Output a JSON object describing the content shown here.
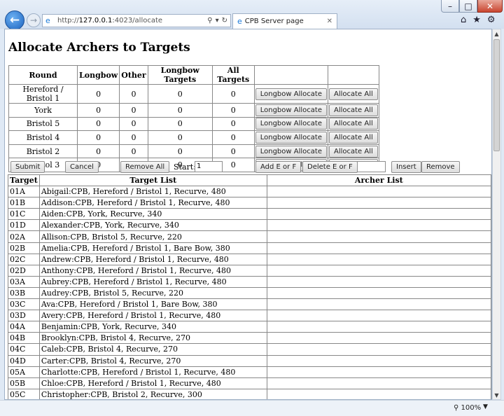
{
  "browser": {
    "url_prefix": "http://",
    "url_host": "127.0.0.1",
    "url_rest": ":4023/allocate",
    "tab_title": "CPB Server page",
    "zoom": "100%"
  },
  "page": {
    "title": "Allocate Archers to Targets",
    "rounds_table": {
      "headers": [
        "Round",
        "Longbow",
        "Other",
        "Longbow Targets",
        "All Targets"
      ],
      "rows": [
        {
          "round": "Hereford / Bristol 1",
          "longbow": "0",
          "other": "0",
          "longbow_targets": "0",
          "all_targets": "0"
        },
        {
          "round": "York",
          "longbow": "0",
          "other": "0",
          "longbow_targets": "0",
          "all_targets": "0"
        },
        {
          "round": "Bristol 5",
          "longbow": "0",
          "other": "0",
          "longbow_targets": "0",
          "all_targets": "0"
        },
        {
          "round": "Bristol 4",
          "longbow": "0",
          "other": "0",
          "longbow_targets": "0",
          "all_targets": "0"
        },
        {
          "round": "Bristol 2",
          "longbow": "0",
          "other": "0",
          "longbow_targets": "0",
          "all_targets": "0"
        },
        {
          "round": "Bristol 3",
          "longbow": "0",
          "other": "0",
          "longbow_targets": "0",
          "all_targets": "0"
        }
      ],
      "longbow_allocate_label": "Longbow Allocate",
      "allocate_all_label": "Allocate All"
    },
    "controls": {
      "submit": "Submit",
      "cancel": "Cancel",
      "remove_all": "Remove All",
      "start_label": "Start:",
      "start_value": "1",
      "add_e_or_f": "Add E or F",
      "delete_e_or_f": "Delete E or F",
      "ef_value": "",
      "insert": "Insert",
      "remove": "Remove"
    },
    "targets_table": {
      "headers": [
        "Target",
        "Target List",
        "Archer List"
      ],
      "rows": [
        {
          "target": "01A",
          "entry": "Abigail:CPB, Hereford / Bristol 1, Recurve, 480",
          "archer": ""
        },
        {
          "target": "01B",
          "entry": "Addison:CPB, Hereford / Bristol 1, Recurve, 480",
          "archer": ""
        },
        {
          "target": "01C",
          "entry": "Aiden:CPB, York, Recurve, 340",
          "archer": ""
        },
        {
          "target": "01D",
          "entry": "Alexander:CPB, York, Recurve, 340",
          "archer": ""
        },
        {
          "target": "02A",
          "entry": "Allison:CPB, Bristol 5, Recurve, 220",
          "archer": ""
        },
        {
          "target": "02B",
          "entry": "Amelia:CPB, Hereford / Bristol 1, Bare Bow, 380",
          "archer": ""
        },
        {
          "target": "02C",
          "entry": "Andrew:CPB, Hereford / Bristol 1, Recurve, 480",
          "archer": ""
        },
        {
          "target": "02D",
          "entry": "Anthony:CPB, Hereford / Bristol 1, Recurve, 480",
          "archer": ""
        },
        {
          "target": "03A",
          "entry": "Aubrey:CPB, Hereford / Bristol 1, Recurve, 480",
          "archer": ""
        },
        {
          "target": "03B",
          "entry": "Audrey:CPB, Bristol 5, Recurve, 220",
          "archer": ""
        },
        {
          "target": "03C",
          "entry": "Ava:CPB, Hereford / Bristol 1, Bare Bow, 380",
          "archer": ""
        },
        {
          "target": "03D",
          "entry": "Avery:CPB, Hereford / Bristol 1, Recurve, 480",
          "archer": ""
        },
        {
          "target": "04A",
          "entry": "Benjamin:CPB, York, Recurve, 340",
          "archer": ""
        },
        {
          "target": "04B",
          "entry": "Brooklyn:CPB, Bristol 4, Recurve, 270",
          "archer": ""
        },
        {
          "target": "04C",
          "entry": "Caleb:CPB, Bristol 4, Recurve, 270",
          "archer": ""
        },
        {
          "target": "04D",
          "entry": "Carter:CPB, Bristol 4, Recurve, 270",
          "archer": ""
        },
        {
          "target": "05A",
          "entry": "Charlotte:CPB, Hereford / Bristol 1, Recurve, 480",
          "archer": ""
        },
        {
          "target": "05B",
          "entry": "Chloe:CPB, Hereford / Bristol 1, Recurve, 480",
          "archer": ""
        },
        {
          "target": "05C",
          "entry": "Christopher:CPB, Bristol 2, Recurve, 300",
          "archer": ""
        }
      ]
    }
  }
}
